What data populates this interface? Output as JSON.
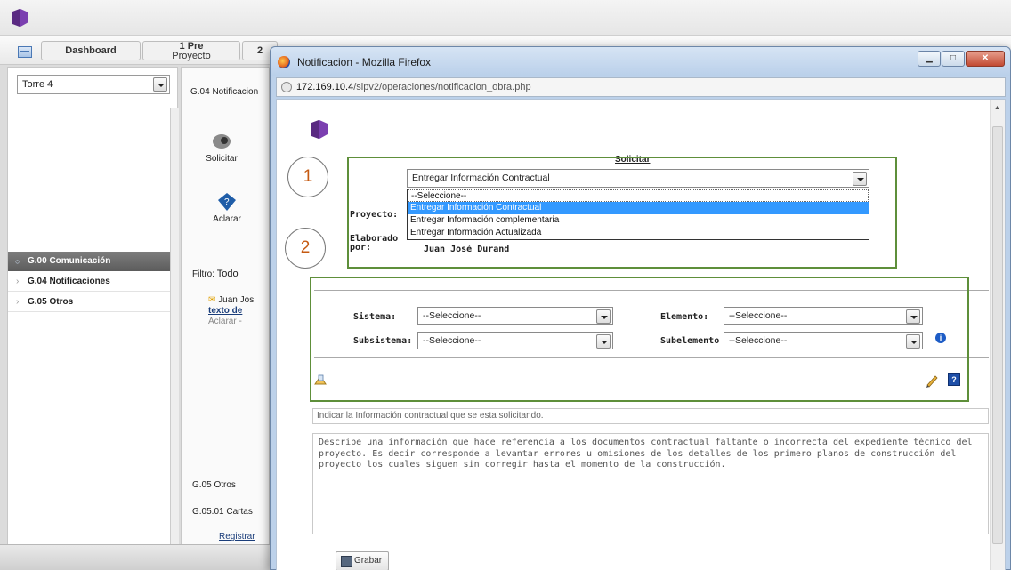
{
  "app": {
    "tabs": [
      "Dashboard",
      "1",
      "Pre",
      "Proyecto",
      "2"
    ],
    "project": "Torre 4",
    "breadcrumb_title": "G.04 Notificacion",
    "toolbar": {
      "solicitar": "Solicitar",
      "aclarar": "Aclarar"
    },
    "nav": {
      "header": "G.00 Comunicación",
      "items": [
        "G.04 Notificaciones",
        "G.05 Otros"
      ]
    },
    "filter_label": "Filtro:",
    "filter_value": "Todo",
    "list_item": {
      "author": "Juan Jos",
      "title": "texto de",
      "action": "Aclarar -"
    },
    "group_otros": "G.05 Otros",
    "group_cartas": "G.05.01 Cartas",
    "registrar": "Registrar"
  },
  "popup": {
    "title": "Notificacion - Mozilla Firefox",
    "url_host": "172.169.10.4",
    "url_path": "/sipv2/operaciones/notificacion_obra.php",
    "form_title": "Solicitar",
    "tipo_selected": "Entregar Información Contractual",
    "tipo_options": [
      "--Seleccione--",
      "Entregar Información Contractual",
      "Entregar Información complementaria",
      "Entregar Información Actualizada"
    ],
    "proyecto_label": "Proyecto:",
    "elaborado_label_1": "Elaborado",
    "elaborado_label_2": "por:",
    "autor": "Juan José Durand",
    "sistema_label": "Sistema:",
    "sistema_value": "--Seleccione--",
    "elemento_label": "Elemento:",
    "elemento_value": "--Seleccione--",
    "subsistema_label": "Subsistema:",
    "subsistema_value": "--Seleccione--",
    "subelemento_label": "Subelemento",
    "subelemento_value": "--Seleccione--",
    "hint": "Indicar la Información contractual que se esta solicitando.",
    "description": "Describe una información que hace referencia a los documentos contractual faltante o incorrecta del expediente técnico del proyecto. Es decir corresponde a levantar errores u omisiones de los detalles de los primero planos de construcción del proyecto los cuales siguen sin corregir hasta el momento de la construcción.",
    "save_label": "Grabar"
  },
  "annotations": {
    "step1": "1",
    "step2": "2"
  },
  "colors": {
    "accent_green": "#5e8f3a",
    "annotation_number": "#c55a11",
    "selection_blue": "#3399ff",
    "brand_purple": "#5a2a82"
  }
}
